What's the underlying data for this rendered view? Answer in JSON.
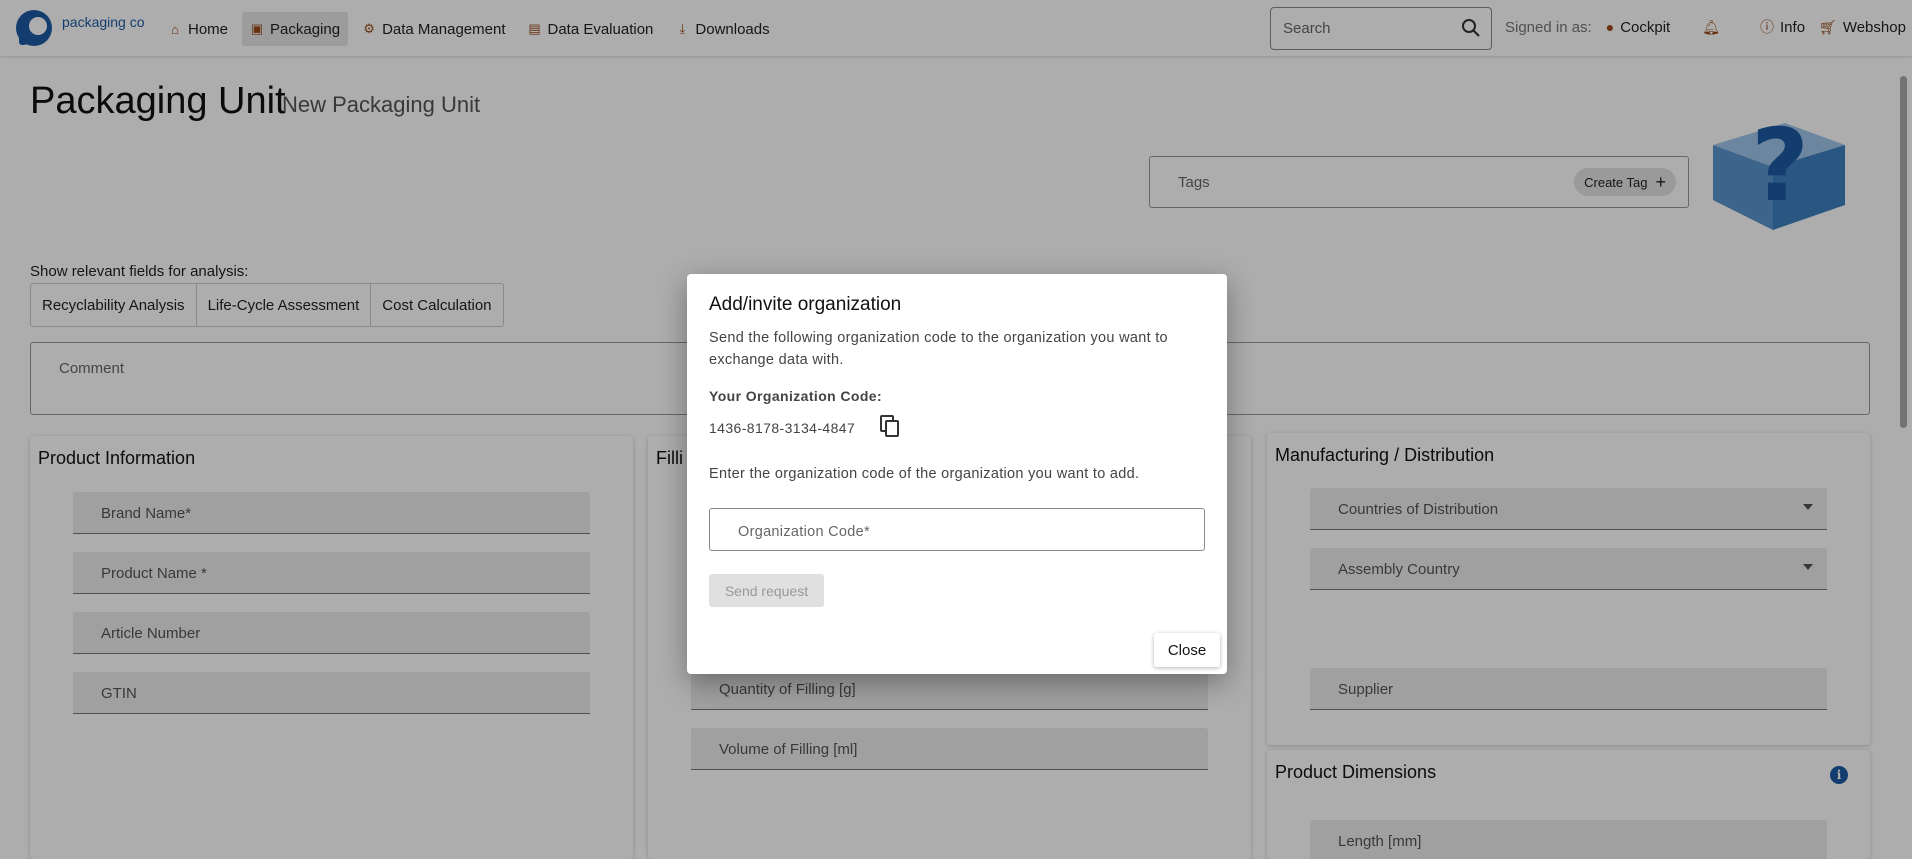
{
  "header": {
    "logo_text": "packaging cockpit",
    "nav": [
      {
        "label": "Home",
        "icon": "home-icon"
      },
      {
        "label": "Packaging",
        "icon": "package-icon",
        "active": true
      },
      {
        "label": "Data Management",
        "icon": "gear-icon"
      },
      {
        "label": "Data Evaluation",
        "icon": "chart-icon"
      },
      {
        "label": "Downloads",
        "icon": "download-icon"
      }
    ],
    "search_placeholder": "Search",
    "signed_in_label": "Signed in as:",
    "user_label": "Cockpit",
    "info_label": "Info",
    "webshop_label": "Webshop"
  },
  "page": {
    "title": "Packaging Unit",
    "subtitle": "New Packaging Unit",
    "tags_label": "Tags",
    "create_tag_label": "Create Tag",
    "analysis_label": "Show relevant fields for analysis:",
    "analysis_tabs": [
      "Recyclability Analysis",
      "Life-Cycle Assessment",
      "Cost Calculation"
    ],
    "comment_label": "Comment"
  },
  "product_info": {
    "title": "Product Information",
    "fields": [
      "Brand Name*",
      "Product Name *",
      "Article Number",
      "GTIN"
    ]
  },
  "filling": {
    "title": "Filli",
    "fields": [
      "Quantity of Filling [g]",
      "Volume of Filling [ml]"
    ]
  },
  "manufacturing": {
    "title": "Manufacturing / Distribution",
    "fields": [
      "Countries of Distribution",
      "Assembly Country",
      "Supplier"
    ]
  },
  "dimensions": {
    "title": "Product Dimensions",
    "fields": [
      "Length [mm]"
    ]
  },
  "dialog": {
    "title": "Add/invite organization",
    "description": "Send the following organization code to the organization you want to exchange data with.",
    "code_label": "Your Organization Code:",
    "code": "1436-8178-3134-4847",
    "enter_text": "Enter the organization code of the organization you want to add.",
    "input_label": "Organization Code*",
    "send_label": "Send request",
    "close_label": "Close"
  },
  "colors": {
    "accent": "#9a4b18",
    "brand_blue": "#1d5aa3",
    "backdrop": "rgba(0,0,0,0.32)"
  }
}
